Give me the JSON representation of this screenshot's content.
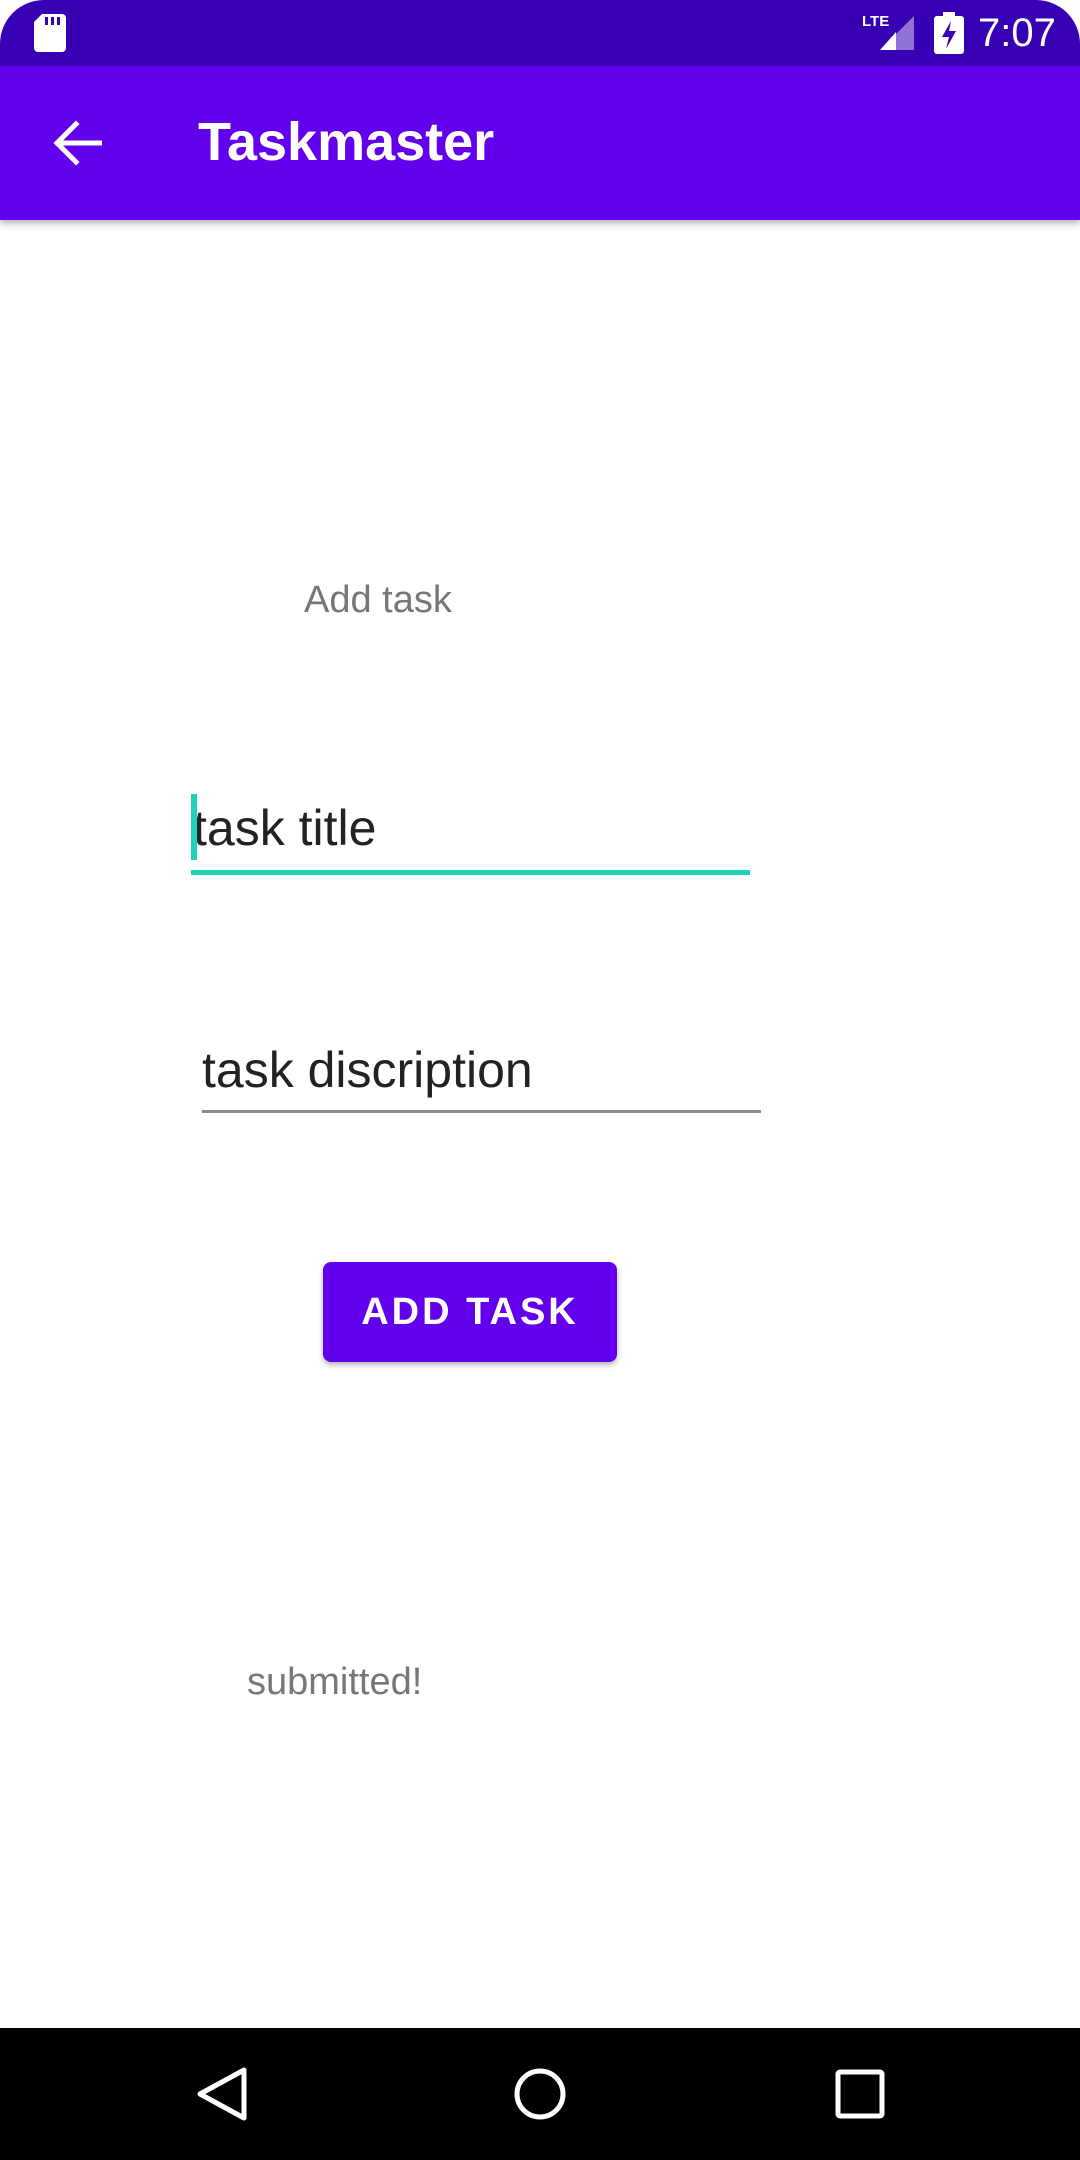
{
  "status_bar": {
    "time": "7:07",
    "network_label": "LTE",
    "icons": [
      "sd-card-icon",
      "lte-signal-icon",
      "battery-charging-icon"
    ],
    "background": "#3700b3"
  },
  "app_bar": {
    "title": "Taskmaster",
    "back_icon": "arrow-back-icon",
    "background": "#6200ee"
  },
  "form": {
    "heading": "Add task",
    "title_field": {
      "value": "task title",
      "focused": true
    },
    "description_field": {
      "value": "task discription"
    },
    "submit_label": "ADD TASK",
    "status_message": "submitted!"
  },
  "colors": {
    "accent": "#1ed1b9",
    "primary": "#6200ee",
    "primary_dark": "#3700b3",
    "secondary_text": "#777777"
  },
  "nav_bar": {
    "icons": [
      "nav-back-icon",
      "nav-home-icon",
      "nav-recents-icon"
    ]
  }
}
